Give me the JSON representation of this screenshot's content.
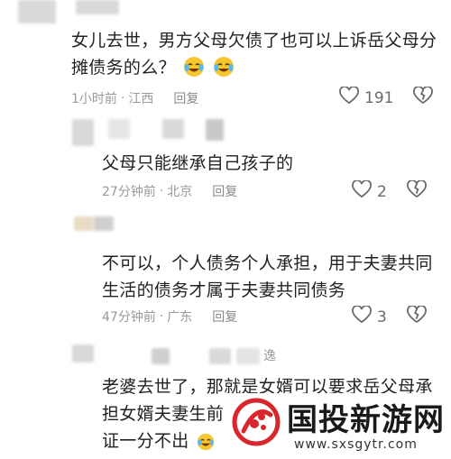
{
  "comments": [
    {
      "text_line1": "女儿去世，男方父母欠债了也可以上诉岳父母分",
      "text_line2": "摊债务的么？",
      "time": "1小时前",
      "location": "江西",
      "reply_label": "回复",
      "likes": "191",
      "emoji": "crying-laughing-emoji"
    },
    {
      "text_line1": "父母只能继承自己孩子的",
      "time": "27分钟前",
      "location": "北京",
      "reply_label": "回复",
      "likes": "2"
    },
    {
      "text_line1": "不可以，个人债务个人承担，用于夫妻共同",
      "text_line2": "生活的债务才属于夫妻共同债务",
      "time": "47分钟前",
      "location": "广东",
      "reply_label": "回复",
      "likes": "3"
    },
    {
      "author_fragment": "逸",
      "text_line1": "老婆去世了，那就是女婿可以要求岳父母承",
      "text_line2": "担女婿夫妻生前",
      "text_line3": "证一分不出"
    }
  ],
  "separator": "·",
  "watermark": {
    "title": "国投新游网",
    "url": "www.sxsgytr.com"
  },
  "colors": {
    "text": "#222222",
    "meta": "#9a9a9a",
    "icon": "#6a6a6a",
    "watermark_red": "#d9272e"
  }
}
